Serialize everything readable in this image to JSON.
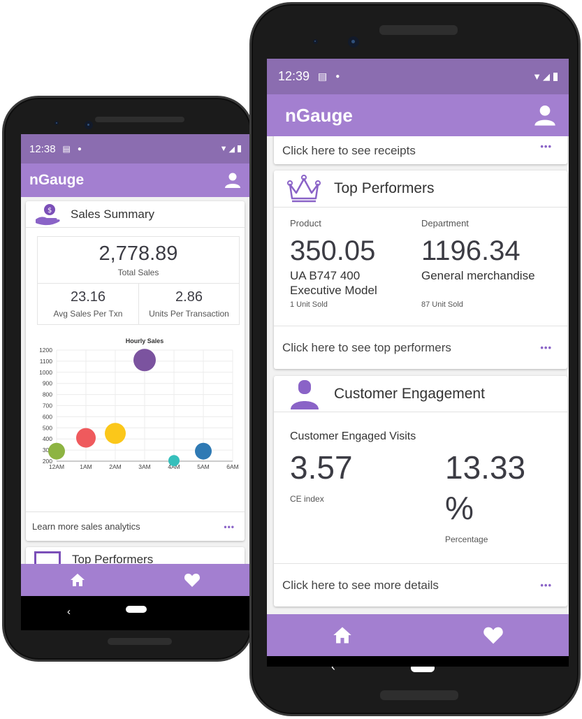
{
  "left_phone": {
    "status": {
      "time": "12:38"
    },
    "app_title": "nGauge",
    "sales_card": {
      "title": "Sales Summary",
      "total_sales_value": "2,778.89",
      "total_sales_label": "Total Sales",
      "avg_value": "23.16",
      "avg_label": "Avg Sales Per Txn",
      "units_value": "2.86",
      "units_label": "Units Per Transaction",
      "footer": "Learn more sales analytics",
      "dots": "•••"
    },
    "next_card_title": "Top Performers",
    "chart_data": {
      "type": "scatter",
      "title": "Hourly Sales",
      "xlabel": "",
      "ylabel": "",
      "categories": [
        "12AM",
        "1AM",
        "2AM",
        "3AM",
        "4AM",
        "5AM",
        "6AM"
      ],
      "ylim": [
        200,
        1200
      ],
      "y_ticks": [
        "1200",
        "1100",
        "1000",
        "900",
        "800",
        "700",
        "600",
        "500",
        "400",
        "300",
        "200"
      ],
      "grid": true,
      "points": [
        {
          "x": "12AM",
          "y": 290,
          "size": 12,
          "color": "#8db442"
        },
        {
          "x": "1AM",
          "y": 410,
          "size": 14,
          "color": "#ef5a5d"
        },
        {
          "x": "2AM",
          "y": 450,
          "size": 15,
          "color": "#fbc71a"
        },
        {
          "x": "3AM",
          "y": 1110,
          "size": 16,
          "color": "#7b539f"
        },
        {
          "x": "4AM",
          "y": 205,
          "size": 8,
          "color": "#36bfbb"
        },
        {
          "x": "5AM",
          "y": 290,
          "size": 12,
          "color": "#2f7ab4"
        }
      ]
    }
  },
  "right_phone": {
    "status": {
      "time": "12:39"
    },
    "app_title": "nGauge",
    "receipts_footer": "Click here to see receipts",
    "top_card": {
      "title": "Top Performers",
      "product_label": "Product",
      "product_value": "350.05",
      "product_name": "UA B747 400 Executive Model",
      "product_units": "1 Unit Sold",
      "dept_label": "Department",
      "dept_value": "1196.34",
      "dept_name": "General merchandise",
      "dept_units": "87 Unit Sold",
      "footer": "Click here to see top performers"
    },
    "engage_card": {
      "title": "Customer Engagement",
      "visits_label": "Customer Engaged Visits",
      "ce_value": "3.57",
      "ce_label": "CE index",
      "pct_value": "13.33",
      "pct_symbol": "%",
      "pct_label": "Percentage",
      "footer": "Click here to see more details"
    },
    "dots": "•••"
  },
  "colors": {
    "app_bar": "#a37fd0",
    "status_bar": "#8b6db0",
    "accent": "#8a63c7"
  },
  "icons": [
    "money-hand-icon",
    "crown-icon",
    "person-icon",
    "home-icon",
    "heart-icon",
    "wifi-icon",
    "signal-icon",
    "battery-icon"
  ]
}
